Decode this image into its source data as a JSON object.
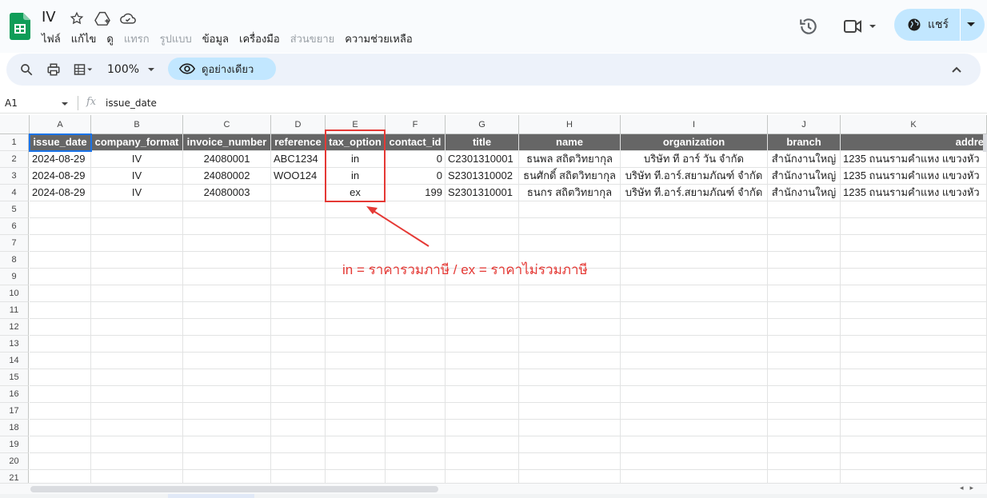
{
  "header": {
    "title": "IV",
    "menu": [
      {
        "label": "ไฟล์",
        "dim": false
      },
      {
        "label": "แก้ไข",
        "dim": false
      },
      {
        "label": "ดู",
        "dim": false
      },
      {
        "label": "แทรก",
        "dim": true
      },
      {
        "label": "รูปแบบ",
        "dim": true
      },
      {
        "label": "ข้อมูล",
        "dim": false
      },
      {
        "label": "เครื่องมือ",
        "dim": false
      },
      {
        "label": "ส่วนขยาย",
        "dim": true
      },
      {
        "label": "ความช่วยเหลือ",
        "dim": false
      }
    ],
    "share_label": "แชร์"
  },
  "toolbar": {
    "zoom": "100%",
    "view_only_label": "ดูอย่างเดียว"
  },
  "formula_bar": {
    "cell_ref": "A1",
    "fx": "fx",
    "value": "issue_date"
  },
  "sheet": {
    "columns": [
      "A",
      "B",
      "C",
      "D",
      "E",
      "F",
      "G",
      "H",
      "I",
      "J",
      "K"
    ],
    "row_numbers": [
      "1",
      "2",
      "3",
      "4",
      "5",
      "6",
      "7",
      "8",
      "9",
      "10",
      "11",
      "12",
      "13",
      "14",
      "15",
      "16",
      "17",
      "18",
      "19",
      "20",
      "21"
    ],
    "header_row": [
      "issue_date",
      "company_format",
      "invoice_number",
      "reference",
      "tax_option",
      "contact_id",
      "title",
      "name",
      "organization",
      "branch",
      "addre"
    ],
    "rows": [
      [
        "2024-08-29",
        "IV",
        "24080001",
        "ABC1234",
        "in",
        "0",
        "C2301310001",
        "ธนพล สถิตวิทยากุล",
        "บริษัท ที อาร์ วัน จำกัด",
        "สำนักงานใหญ่",
        "1235 ถนนรามคำแหง แขวงหัว"
      ],
      [
        "2024-08-29",
        "IV",
        "24080002",
        "WOO124",
        "in",
        "0",
        "S2301310002",
        "ธนศักดิ์ สถิตวิทยากุล",
        "บริษัท ที.อาร์.สยามภัณฑ์ จำกัด",
        "สำนักงานใหญ่",
        "1235 ถนนรามคำแหง แขวงหัว"
      ],
      [
        "2024-08-29",
        "IV",
        "24080003",
        "",
        "ex",
        "199",
        "S2301310001",
        "ธนกร สถิตวิทยากุล",
        "บริษัท ที.อาร์.สยามภัณฑ์ จำกัด",
        "สำนักงานใหญ่",
        "1235 ถนนรามคำแหง แขวงหัว"
      ]
    ]
  },
  "annotation": {
    "text": "in = ราคารวมภาษี / ex =  ราคาไม่รวมภาษี",
    "color": "#e53935"
  },
  "colors": {
    "accent": "#c2e7ff",
    "header_fill": "#666666",
    "sheets_green": "#0f9d58"
  }
}
